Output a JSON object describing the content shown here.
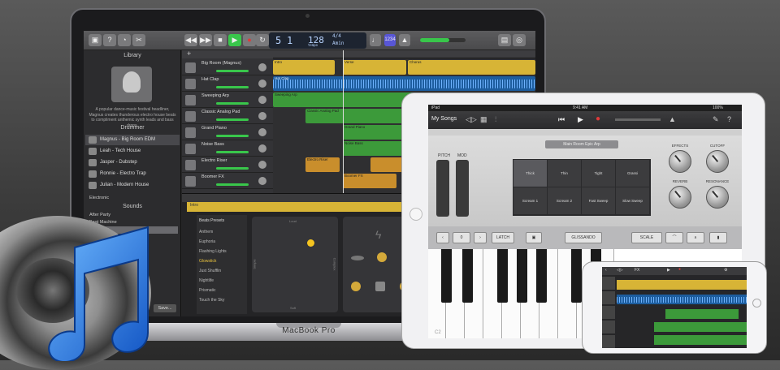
{
  "macbook": {
    "label": "MacBook Pro",
    "lcd": {
      "bar": "5",
      "beat": "1",
      "tempo": "128",
      "time_sig": "4/4",
      "key": "Amin",
      "tempo_label": "tempo"
    },
    "count_in": "1234",
    "library": {
      "title": "Library",
      "description": "A popular dance-music festival headliner, Magnus creates thunderous electro house beats to compliment anthemic synth leads and bass drops.",
      "drummer_heading": "Drummer",
      "drummers": [
        {
          "name": "Magnus - Big Room EDM",
          "selected": true
        },
        {
          "name": "Leah - Tech House",
          "selected": false
        },
        {
          "name": "Jasper - Dubstep",
          "selected": false
        },
        {
          "name": "Ronnie - Electro Trap",
          "selected": false
        },
        {
          "name": "Julian - Modern House",
          "selected": false
        }
      ],
      "genre": "Electronic",
      "sounds_heading": "Sounds",
      "sounds": [
        {
          "name": "After Party",
          "selected": false
        },
        {
          "name": "Beat Machine",
          "selected": false
        },
        {
          "name": "Big Room",
          "selected": true
        }
      ],
      "save_label": "Save..."
    },
    "tracks": [
      {
        "name": "Big Room (Magnus)"
      },
      {
        "name": "Hat Clap"
      },
      {
        "name": "Sweeping Arp"
      },
      {
        "name": "Classic Analog Pad"
      },
      {
        "name": "Grand Piano"
      },
      {
        "name": "Noise Bass"
      },
      {
        "name": "Electro Riser"
      },
      {
        "name": "Boomer FX"
      }
    ],
    "regions": {
      "intro": "Intro",
      "verse": "Verse",
      "chorus": "Chorus",
      "hat_clap": "Hat Clap",
      "sweeping_arp": "Sweeping Arp",
      "classic_analog_pad": "Classic Analog Pad",
      "grand_piano": "Grand Piano",
      "noise_bass": "Noise Bass",
      "electro_riser": "Electro Riser",
      "boomer_fx": "Boomer FX"
    },
    "beat_editor": {
      "region_label": "Intro",
      "presets_heading": "Beats Presets",
      "presets": [
        {
          "name": "Anthem",
          "selected": false
        },
        {
          "name": "Euphoria",
          "selected": false
        },
        {
          "name": "Flashing Lights",
          "selected": false
        },
        {
          "name": "Glowstick",
          "selected": true
        },
        {
          "name": "Just Shufflin",
          "selected": false
        },
        {
          "name": "Nightlife",
          "selected": false
        },
        {
          "name": "Prismatic",
          "selected": false
        },
        {
          "name": "Touch the Sky",
          "selected": false
        }
      ],
      "xy_top": "Loud",
      "xy_bottom": "Soft",
      "xy_left": "Simple",
      "xy_right": "Complex"
    }
  },
  "ipad": {
    "status": {
      "left": "iPad",
      "time": "9:41 AM",
      "battery": "100%"
    },
    "my_songs": "My Songs",
    "preset_name": "Main Room Epic Arp",
    "pitch_label": "PITCH",
    "mod_label": "MOD",
    "grid_cells": [
      "Thick",
      "Thin",
      "Tight",
      "Grassi",
      "Scream 1",
      "Scream 2",
      "Fast Sweep",
      "Slow Sweep"
    ],
    "selected_cell": 0,
    "knobs": [
      "EFFECTS",
      "CUTOFF",
      "REVERB",
      "RESONANCE"
    ],
    "octave_value": "0",
    "latch_label": "LATCH",
    "glissando_label": "GLISSANDO",
    "scale_label": "SCALE",
    "key_label": "C2"
  },
  "iphone": {
    "fx_label": "FX"
  },
  "colors": {
    "yellow_region": "#d7b436",
    "blue_region": "#1d5d9e",
    "green_region": "#3c9a3a",
    "orange_region": "#c98e2c",
    "play_green": "#39c64b",
    "record_red": "#e03a3a",
    "note_blue": "#2a7de1"
  }
}
